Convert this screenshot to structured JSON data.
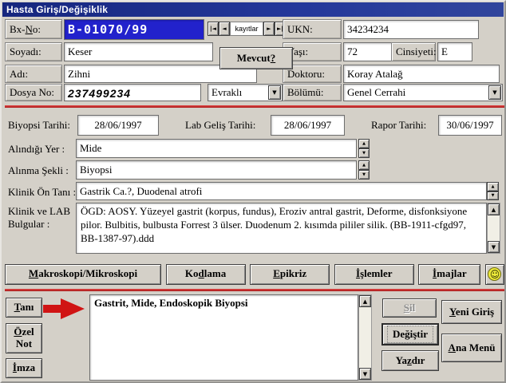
{
  "window": {
    "title": "Hasta Giriş/Değişiklik"
  },
  "colors": {
    "titlebar_blue": "#1e2f8e",
    "selection_blue": "#2222cc",
    "separator_red": "#c42828",
    "smiley_yellow": "#ece93a",
    "disabled_gray": "#8e8e8e"
  },
  "icons": {
    "dropdown_icon": "▼",
    "spinner_up_icon": "▲",
    "spinner_down_icon": "▼",
    "scroll_up_icon": "▲",
    "scroll_down_icon": "▼",
    "smiley_icon": "☺"
  },
  "identity": {
    "bx_no": {
      "label": {
        "text": "Bx-No:",
        "u": 3
      },
      "value": "B-01070/99"
    },
    "nav": {
      "first_icon": "|◄",
      "prev_icon": "◄",
      "records_label": "kayıtlar",
      "next_icon": "►",
      "last_icon": "►|"
    },
    "ukn": {
      "label": "UKN:",
      "value": "34234234"
    },
    "soyadi": {
      "label": "Soyadı:",
      "value": "Keser"
    },
    "mevcut_button": {
      "text": "Mevcut?",
      "u": 6
    },
    "yasi": {
      "label": "Yaşı:",
      "value": "72"
    },
    "cinsiyeti": {
      "label": "Cinsiyeti:",
      "value": "E"
    },
    "adi": {
      "label": "Adı:",
      "value": "Zihni"
    },
    "doktoru": {
      "label": "Doktoru:",
      "value": "Koray Atalağ"
    },
    "dosya_no": {
      "label": "Dosya No:",
      "value": "237499234"
    },
    "evrak": {
      "value": "Evraklı"
    },
    "bolumu": {
      "label": "Bölümü:",
      "value": "Genel Cerrahi"
    }
  },
  "dates": {
    "biyopsi": {
      "label": "Biyopsi Tarihi:",
      "value": "28/06/1997"
    },
    "lab_gelis": {
      "label": "Lab Geliş Tarihi:",
      "value": "28/06/1997"
    },
    "rapor": {
      "label": "Rapor Tarihi:",
      "value": "30/06/1997"
    }
  },
  "specimen": {
    "alindigi_yer": {
      "label": "Alındığı Yer :",
      "value": "Mide"
    },
    "alinma_sekli": {
      "label": "Alınma Şekli :",
      "value": "Biyopsi"
    },
    "klinik_on_tani": {
      "label": "Klinik Ön Tanı :",
      "value": "Gastrik Ca.?, Duodenal atrofi"
    },
    "bulgular": {
      "label_line1": "Klinik ve LAB",
      "label_line2": "Bulgular :",
      "value": "ÖGD: AOSY. Yüzeyel gastrit (korpus, fundus), Eroziv antral gastrit, Deforme, disfonksiyone pilor. Bulbitis, bulbusta Forrest 3 ülser. Duodenum 2. kısımda pililer silik. (BB-1911-cfgd97, BB-1387-97).ddd"
    }
  },
  "toolbar": {
    "makroskopi": {
      "text": "Makroskopi/Mikroskopi",
      "u": 0
    },
    "kodlama": {
      "text": "Kodlama",
      "u": 2
    },
    "epikriz": {
      "text": "Epikriz",
      "u": 0
    },
    "islemler": {
      "text": "İşlemler",
      "u": 0
    },
    "imajlar": {
      "text": "İmajlar",
      "u": 0
    }
  },
  "diagnosis": {
    "tani_button": {
      "text": "Tanı",
      "u": 0
    },
    "ozel_not_button": {
      "text": "Özel Not",
      "u": 0
    },
    "imza_button": {
      "text": "İmza",
      "u": 0
    },
    "value": "Gastrit, Mide, Endoskopik Biyopsi"
  },
  "actions": {
    "sil": {
      "text": "Sil",
      "u": 0
    },
    "yeni_giris": {
      "text": "Yeni Giriş",
      "u": 0
    },
    "degistir": {
      "text": "Değiştir",
      "u": 2
    },
    "ana_menu": {
      "text": "Ana Menü",
      "u": 0
    },
    "yazdir": {
      "text": "Yazdır",
      "u": 2
    }
  }
}
